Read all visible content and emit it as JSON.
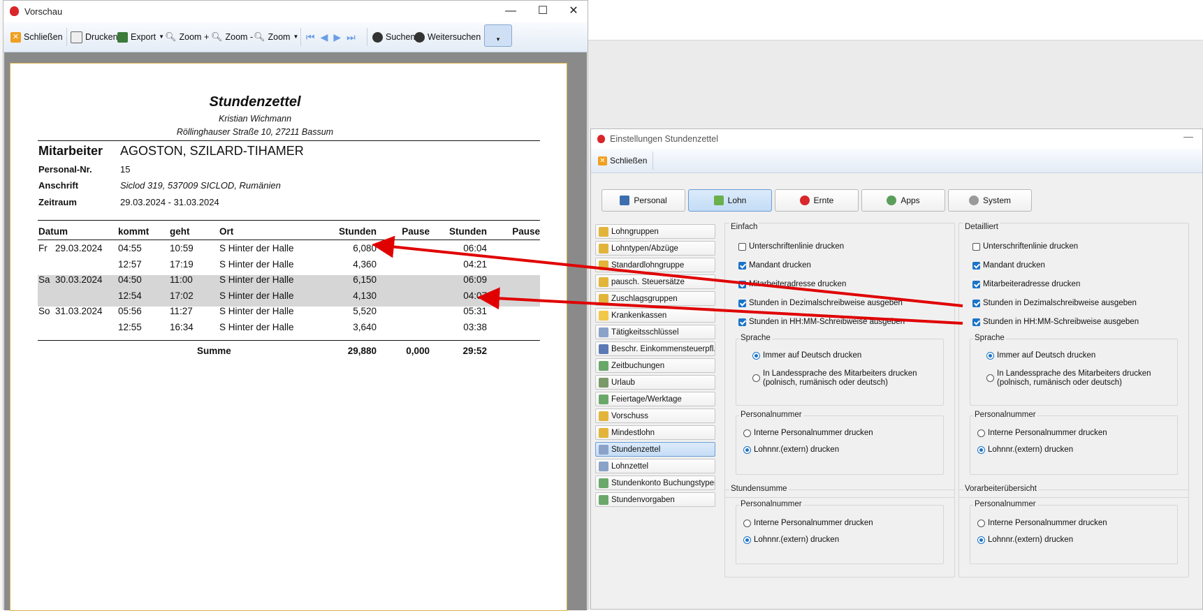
{
  "preview_window": {
    "title": "Vorschau",
    "toolbar": {
      "close": "Schließen",
      "print": "Drucken",
      "export": "Export",
      "zoom_in": "Zoom +",
      "zoom_out": "Zoom -",
      "zoom": "Zoom",
      "search": "Suchen",
      "search_next": "Weitersuchen"
    },
    "report": {
      "title": "Stundenzettel",
      "company_name": "Kristian Wichmann",
      "company_address": "Röllinghauser Straße 10, 27211 Bassum",
      "employee_label": "Mitarbeiter",
      "employee_name": "AGOSTON, SZILARD-TIHAMER",
      "personal_nr_label": "Personal-Nr.",
      "personal_nr": "15",
      "address_label": "Anschrift",
      "address": "Siclod 319, 537009 SICLOD, Rumänien",
      "period_label": "Zeitraum",
      "period": "29.03.2024 - 31.03.2024",
      "columns": [
        "Datum",
        "kommt",
        "geht",
        "Ort",
        "Stunden",
        "Pause",
        "Stunden",
        "Pause"
      ],
      "rows": [
        {
          "day": "Fr",
          "date": "29.03.2024",
          "kommt": "04:55",
          "geht": "10:59",
          "ort": "S Hinter der Halle",
          "stunden": "6,080",
          "pause": "",
          "stunden_hm": "06:04",
          "pause_hm": ""
        },
        {
          "day": "",
          "date": "",
          "kommt": "12:57",
          "geht": "17:19",
          "ort": "S Hinter der Halle",
          "stunden": "4,360",
          "pause": "",
          "stunden_hm": "04:21",
          "pause_hm": ""
        },
        {
          "day": "Sa",
          "date": "30.03.2024",
          "kommt": "04:50",
          "geht": "11:00",
          "ort": "S Hinter der Halle",
          "stunden": "6,150",
          "pause": "",
          "stunden_hm": "06:09",
          "pause_hm": ""
        },
        {
          "day": "",
          "date": "",
          "kommt": "12:54",
          "geht": "17:02",
          "ort": "S Hinter der Halle",
          "stunden": "4,130",
          "pause": "",
          "stunden_hm": "04:07",
          "pause_hm": ""
        },
        {
          "day": "So",
          "date": "31.03.2024",
          "kommt": "05:56",
          "geht": "11:27",
          "ort": "S Hinter der Halle",
          "stunden": "5,520",
          "pause": "",
          "stunden_hm": "05:31",
          "pause_hm": ""
        },
        {
          "day": "",
          "date": "",
          "kommt": "12:55",
          "geht": "16:34",
          "ort": "S Hinter der Halle",
          "stunden": "3,640",
          "pause": "",
          "stunden_hm": "03:38",
          "pause_hm": ""
        }
      ],
      "sum_label": "Summe",
      "sum_stunden": "29,880",
      "sum_pause": "0,000",
      "sum_stunden_hm": "29:52"
    }
  },
  "settings_window": {
    "title": "Einstellungen Stundenzettel",
    "close": "Schließen",
    "tabs": [
      "Personal",
      "Lohn",
      "Ernte",
      "Apps",
      "System"
    ],
    "nav_items": [
      "Lohngruppen",
      "Lohntypen/Abzüge",
      "Standardlohngruppe",
      "pausch. Steuersätze",
      "Zuschlagsgruppen",
      "Krankenkassen",
      "Tätigkeitsschlüssel",
      "Beschr. Einkommensteuerpfl.",
      "Zeitbuchungen",
      "Urlaub",
      "Feiertage/Werktage",
      "Vorschuss",
      "Mindestlohn",
      "Stundenzettel",
      "Lohnzettel",
      "Stundenkonto Buchungstypen",
      "Stundenvorgaben"
    ],
    "einfach": {
      "label": "Einfach",
      "sig_line": "Unterschriftenlinie drucken",
      "mandant": "Mandant drucken",
      "mitarbeiteradresse": "Mitarbeiteradresse drucken",
      "dezimal": "Stunden in Dezimalschreibweise ausgeben",
      "hhmm": "Stunden in HH:MM-Schreibweise ausgeben",
      "sprache_label": "Sprache",
      "sprache_deutsch": "Immer auf Deutsch drucken",
      "sprache_landessprache_1": "In Landessprache des Mitarbeiters drucken",
      "sprache_landessprache_2": "(polnisch, rumänisch oder deutsch)",
      "personalnummer_label": "Personalnummer",
      "pn_intern": "Interne Personalnummer drucken",
      "pn_extern": "Lohnnr.(extern) drucken"
    },
    "detailliert": {
      "label": "Detailliert",
      "sig_line": "Unterschriftenlinie drucken",
      "mandant": "Mandant drucken",
      "mitarbeiteradresse": "Mitarbeiteradresse drucken",
      "dezimal": "Stunden in Dezimalschreibweise ausgeben",
      "hhmm": "Stunden in HH:MM-Schreibweise ausgeben",
      "sprache_label": "Sprache",
      "sprache_deutsch": "Immer auf Deutsch drucken",
      "sprache_landessprache_1": "In Landessprache des Mitarbeiters drucken",
      "sprache_landessprache_2": "(polnisch, rumänisch oder deutsch)",
      "personalnummer_label": "Personalnummer",
      "pn_intern": "Interne Personalnummer drucken",
      "pn_extern": "Lohnnr.(extern) drucken"
    },
    "stundensumme": {
      "label": "Stundensumme",
      "personalnummer_label": "Personalnummer",
      "pn_intern": "Interne Personalnummer drucken",
      "pn_extern": "Lohnnr.(extern) drucken"
    },
    "vorarbeiter": {
      "label": "Vorarbeiterübersicht",
      "personalnummer_label": "Personalnummer",
      "pn_intern": "Interne Personalnummer drucken",
      "pn_extern": "Lohnnr.(extern) drucken"
    }
  },
  "colors": {
    "arrow": "#e00000",
    "accent": "#1a73c8"
  }
}
